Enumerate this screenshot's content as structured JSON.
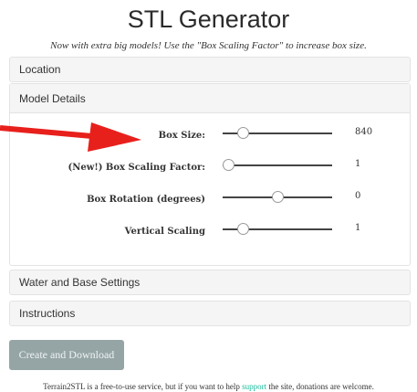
{
  "header": {
    "title": "STL Generator",
    "subtitle": "Now with extra big models! Use the \"Box Scaling Factor\" to increase box size."
  },
  "panels": {
    "location": "Location",
    "model_details": "Model Details",
    "water_base": "Water and Base Settings",
    "instructions": "Instructions"
  },
  "sliders": [
    {
      "label": "Box Size:",
      "value": "840",
      "position": 0.18
    },
    {
      "label": "(New!) Box Scaling Factor:",
      "value": "1",
      "position": 0.05
    },
    {
      "label": "Box Rotation (degrees)",
      "value": "0",
      "position": 0.5
    },
    {
      "label": "Vertical Scaling",
      "value": "1",
      "position": 0.18
    }
  ],
  "actions": {
    "create_download": "Create and Download"
  },
  "footer": {
    "before": "Terrain2STL is a free-to-use service, but if you want to help ",
    "link": "support",
    "after": " the site, donations are welcome."
  },
  "colors": {
    "accent": "#18bc9c",
    "button": "#95a5a6",
    "arrow": "#e8201c"
  }
}
